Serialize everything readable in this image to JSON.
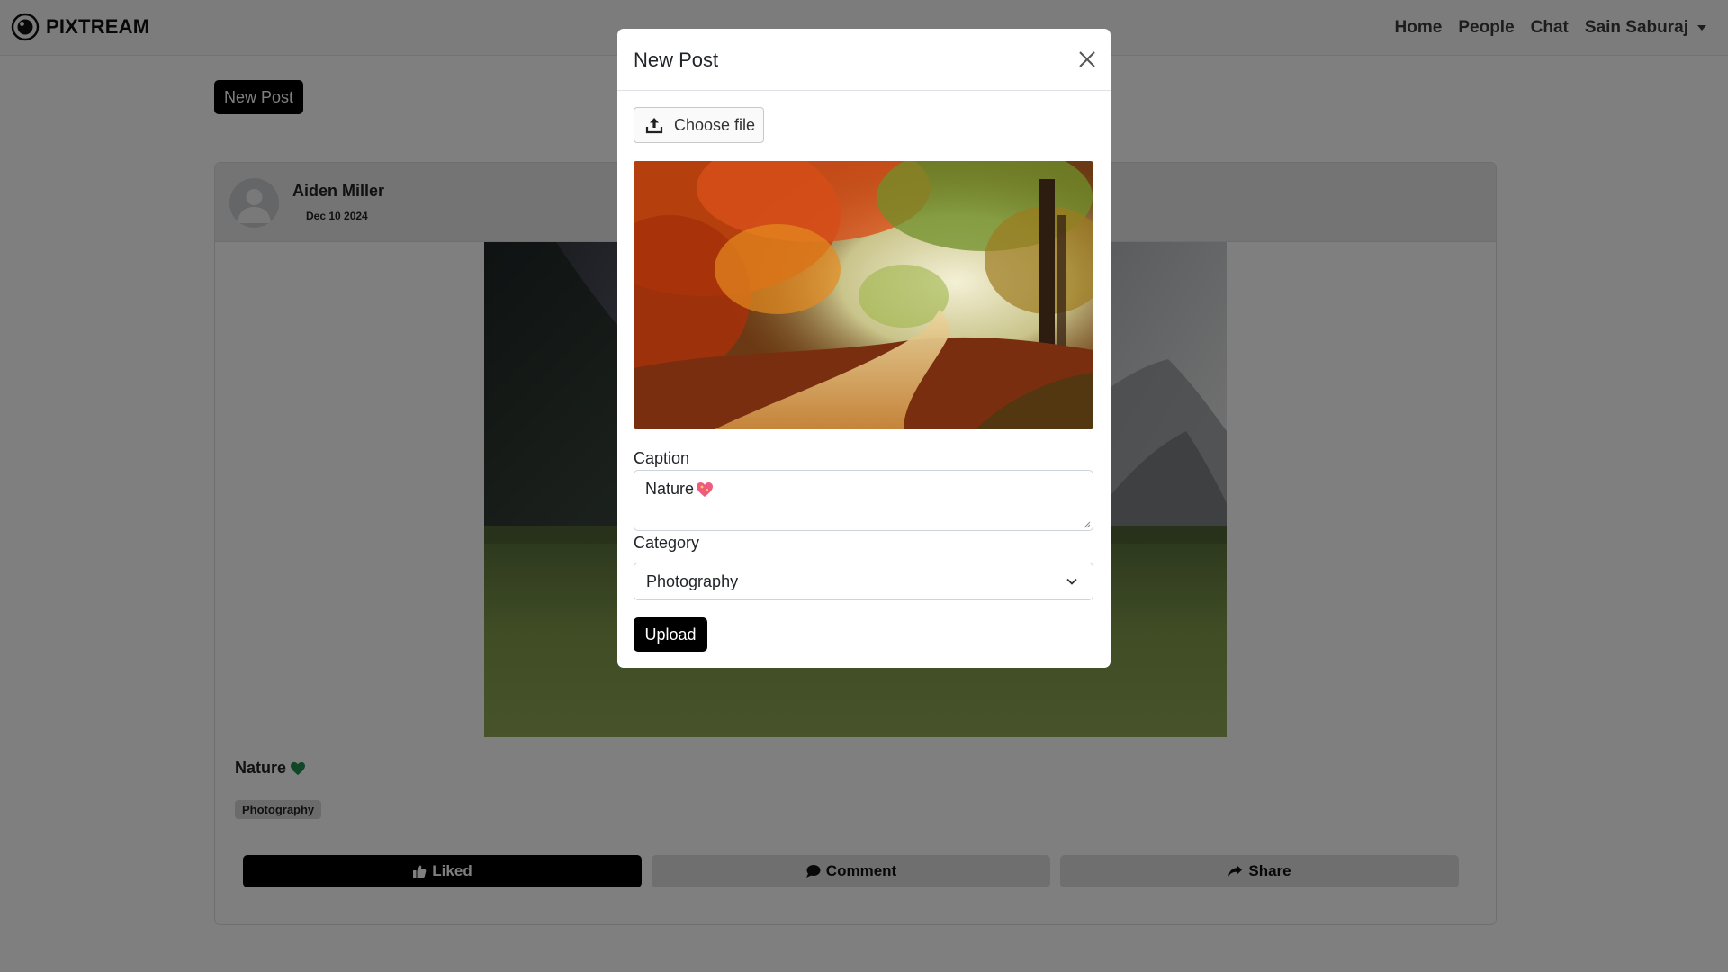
{
  "navbar": {
    "brand": "PIXTREAM",
    "links": [
      "Home",
      "People",
      "Chat"
    ],
    "user": "Sain Saburaj"
  },
  "page": {
    "new_post_label": "New Post"
  },
  "post": {
    "author": "Aiden Miller",
    "date": "Dec 10 2024",
    "caption": "Nature",
    "caption_emoji": "green-heart-icon",
    "category": "Photography",
    "actions": {
      "like": "Liked",
      "comment": "Comment",
      "share": "Share"
    }
  },
  "modal": {
    "title": "New Post",
    "choose_file_label": "Choose file",
    "caption_label": "Caption",
    "caption_value": "Nature",
    "caption_emoji": "sparkling-heart-icon",
    "category_label": "Category",
    "category_value": "Photography",
    "upload_label": "Upload"
  },
  "colors": {
    "primary": "#000000",
    "backdrop": "rgba(0,0,0,0.5)",
    "secondary_button": "#dedede",
    "green_heart": "#1e8f4e",
    "pink_heart": "#f05a7e"
  }
}
